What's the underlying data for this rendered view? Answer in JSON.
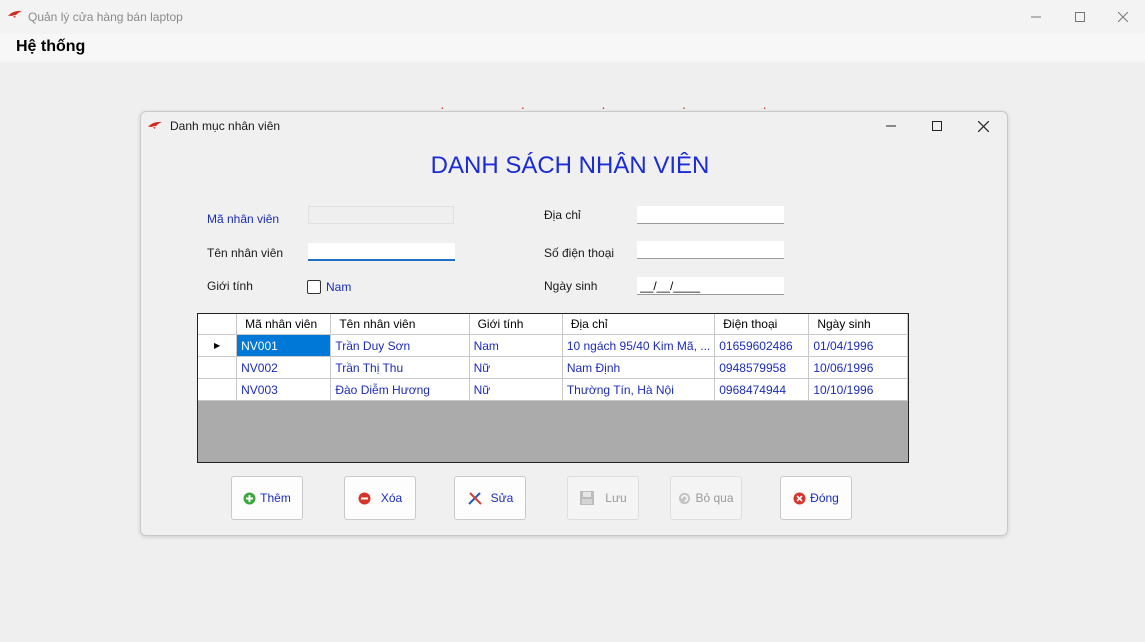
{
  "window": {
    "title": "Quản lý cửa hàng bán laptop"
  },
  "menu": {
    "items": [
      {
        "label": "Hệ thống"
      }
    ]
  },
  "form": {
    "title": "Danh mục nhân viên",
    "heading": "DANH SÁCH NHÂN VIÊN",
    "fields": {
      "ma_nhan_vien": {
        "label": "Mã nhân viên",
        "value": ""
      },
      "ten_nhan_vien": {
        "label": "Tên nhân viên",
        "value": ""
      },
      "gioi_tinh": {
        "label": "Giới tính",
        "checkbox_label": "Nam",
        "checked": false
      },
      "dia_chi": {
        "label": "Địa chỉ",
        "value": ""
      },
      "so_dien_thoai": {
        "label": "Số điện thoại",
        "value": ""
      },
      "ngay_sinh": {
        "label": "Ngày sinh",
        "value": "__/__/____"
      }
    },
    "grid": {
      "columns": [
        "Mã nhân viên",
        "Tên nhân viên",
        "Giới tính",
        "Địa chỉ",
        "Điện thoại",
        "Ngày sinh"
      ],
      "rows": [
        [
          "NV001",
          "Trần Duy Sơn",
          "Nam",
          "10 ngách 95/40 Kim Mã, ...",
          "01659602486",
          "01/04/1996"
        ],
        [
          "NV002",
          "Trần Thị Thu",
          "Nữ",
          "Nam Định",
          "0948579958",
          "10/06/1996"
        ],
        [
          "NV003",
          "Đào Diễm Hương",
          "Nữ",
          "Thường Tín, Hà Nội",
          "0968474944",
          "10/10/1996"
        ]
      ],
      "current_row_marker": "▶"
    },
    "buttons": {
      "them": "Thêm",
      "xoa": "Xóa",
      "sua": "Sửa",
      "luu": "Lưu",
      "bo_qua": "Bỏ qua",
      "dong": "Đóng"
    }
  },
  "icons": {
    "minimize": "minimize-icon",
    "maximize": "maximize-icon",
    "close": "close-icon"
  },
  "colors": {
    "heading": "#1b2bd6",
    "selection": "#0078d7",
    "label": "#1b2bbd"
  }
}
